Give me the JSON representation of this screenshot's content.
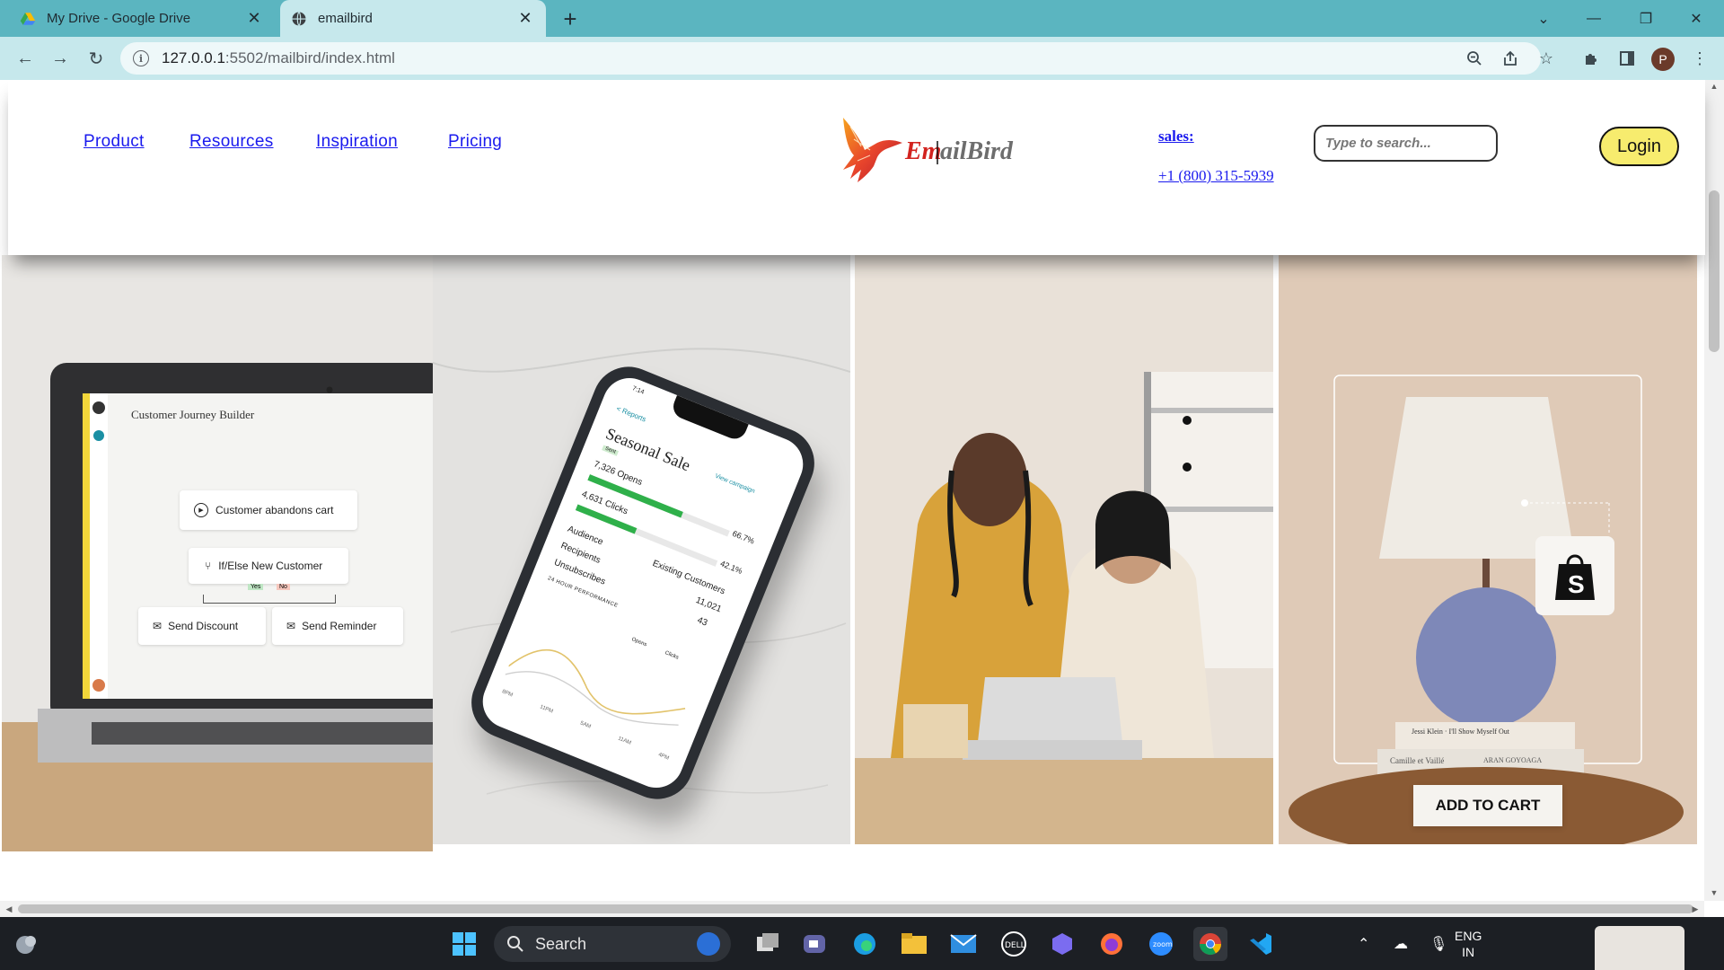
{
  "browser": {
    "tabs": [
      {
        "title": "My Drive - Google Drive",
        "active": false,
        "icon": "google-drive-icon"
      },
      {
        "title": "emailbird",
        "active": true,
        "icon": "globe-icon"
      }
    ],
    "address_bar": {
      "host": "127.0.0.1",
      "path": ":5502/mailbird/index.html"
    },
    "profile_initial": "P"
  },
  "site": {
    "nav": [
      "Product",
      "Resources",
      "Inspiration",
      "Pricing"
    ],
    "logo_text_a": "Em",
    "logo_text_b": "ailBird",
    "sales_label": "sales:",
    "sales_phone": "+1 (800) 315-5939",
    "search_placeholder": "Type to search...",
    "login_label": "Login"
  },
  "hero": {
    "laptop": {
      "app_title": "Customer Journey Builder",
      "nodes": {
        "trigger": "Customer abandons cart",
        "condition": "If/Else New Customer",
        "yes": "Yes",
        "no": "No",
        "action_a": "Send Discount",
        "action_b": "Send Reminder"
      }
    },
    "phone": {
      "time": "7:14",
      "back": "< Reports",
      "title": "Seasonal Sale",
      "badge": "Sent",
      "view": "View campaign",
      "opens": "7,326 Opens",
      "opens_pct": "66.7%",
      "clicks": "4,631 Clicks",
      "clicks_pct": "42.1%",
      "rows": [
        {
          "label": "Audience",
          "value": "Existing Customers"
        },
        {
          "label": "Recipients",
          "value": "11,021"
        },
        {
          "label": "Unsubscribes",
          "value": "43"
        }
      ],
      "perf": "24 HOUR PERFORMANCE",
      "legend_opens": "Opens",
      "legend_clicks": "Clicks",
      "axis": [
        "8PM",
        "11PM",
        "5AM",
        "11AM",
        "4PM"
      ]
    },
    "shop": {
      "cta": "ADD TO CART",
      "book1": "Jessi Klein · I'll Show Myself Out",
      "book2_a": "Camille et Vaillé",
      "book2_b": "ARAN GOYOAGA"
    }
  },
  "taskbar": {
    "search_label": "Search",
    "lang_line1": "ENG",
    "lang_line2": "IN"
  }
}
